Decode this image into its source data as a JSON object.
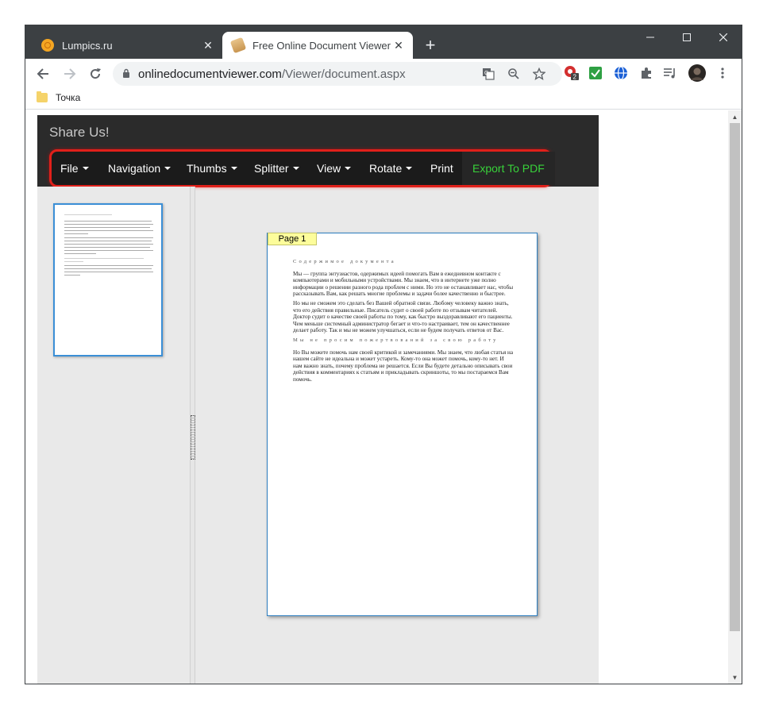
{
  "browser": {
    "tabs": [
      {
        "title": "Lumpics.ru",
        "active": false
      },
      {
        "title": "Free Online Document Viewer",
        "active": true
      }
    ],
    "url_host": "onlinedocumentviewer.com",
    "url_path": "/Viewer/document.aspx",
    "bookmarks": [
      {
        "label": "Точка"
      }
    ],
    "extension_badge": "2"
  },
  "app": {
    "share_text": "Share Us!",
    "menu": [
      {
        "label": "File",
        "has_caret": true
      },
      {
        "label": "Navigation",
        "has_caret": true
      },
      {
        "label": "Thumbs",
        "has_caret": true
      },
      {
        "label": "Splitter",
        "has_caret": true
      },
      {
        "label": "View",
        "has_caret": true
      },
      {
        "label": "Rotate",
        "has_caret": true
      },
      {
        "label": "Print",
        "has_caret": false
      },
      {
        "label": "Export To PDF",
        "has_caret": false
      }
    ],
    "accent_highlight": "#e0201a",
    "export_color": "#38d23a"
  },
  "document": {
    "page_label": "Page 1",
    "heading1": "Содержимое документа",
    "para1": "Мы — группа энтузиастов, одержимых идеей помогать Вам в ежедневном контакте с компьютерами и мобильными устройствами. Мы знаем, что в интернете уже полно информации о решении разного рода проблем с ними. Но это не останавливает нас, чтобы рассказывать Вам, как решать многие проблемы и задачи более качественно и быстрее.",
    "para2": "Но мы не сможем это сделать без Вашей обратной связи. Любому человеку важно знать, что его действия правильные. Писатель судит о своей работе по отзывам читателей. Доктор судит о качестве своей работы по тому, как быстро выздоравливают его пациенты. Чем меньше системный администратор бегает и что-то настраивает, тем он качественнее делает работу. Так и мы не можем улучшаться, если не будем получать ответов от Вас.",
    "heading2": "Мы не просим пожертвований за свою работу",
    "para3": "Но Вы можете помочь нам своей критикой и замечаниями. Мы знаем, что любая статья на нашем сайте не идеальна и может устареть. Кому-то она может помочь, кому-то нет. И нам важно знать, почему проблема не решается. Если Вы будете детально описывать свои действия в комментариях к статьям и прикладывать скриншоты, то мы постараемся Вам помочь."
  }
}
